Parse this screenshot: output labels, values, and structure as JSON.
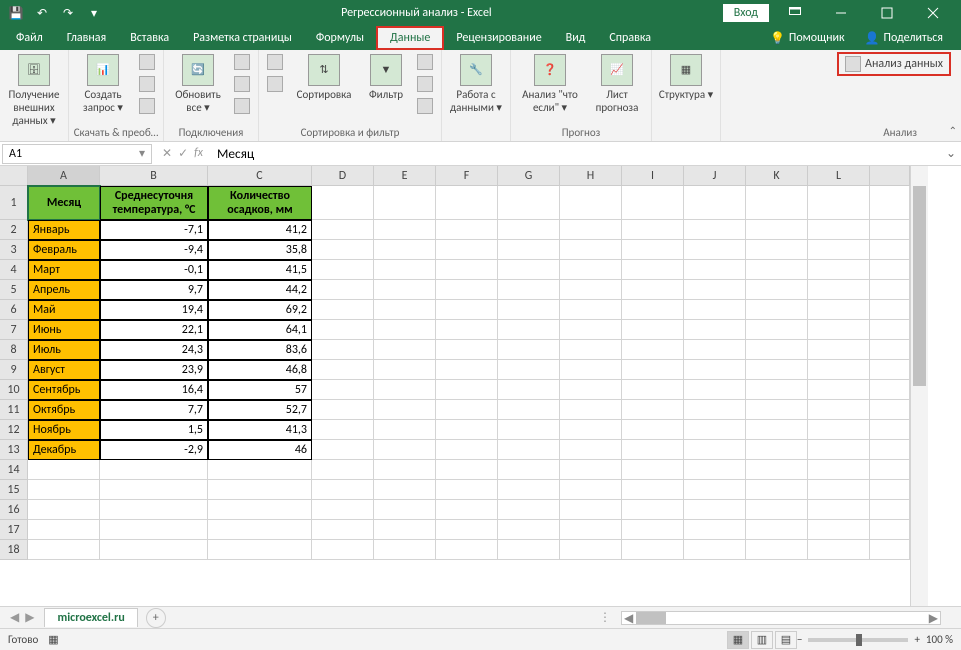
{
  "title": "Регрессионный анализ  -  Excel",
  "signin": "Вход",
  "tabs": [
    "Файл",
    "Главная",
    "Вставка",
    "Разметка страницы",
    "Формулы",
    "Данные",
    "Рецензирование",
    "Вид",
    "Справка"
  ],
  "active_tab": "Данные",
  "ribbon_right": {
    "tell_me": "Помощник",
    "share": "Поделиться"
  },
  "ribbon": {
    "external": {
      "btn": "Получение внешних данных ▾"
    },
    "get_transform": {
      "btn": "Создать запрос ▾",
      "label": "Скачать & преоб…"
    },
    "connections": {
      "btn": "Обновить все ▾",
      "label": "Подключения"
    },
    "sort_filter": {
      "sort": "Сортировка",
      "filter": "Фильтр",
      "label": "Сортировка и фильтр"
    },
    "data_tools": {
      "btn": "Работа с данными ▾"
    },
    "forecast": {
      "whatif": "Анализ \"что если\" ▾",
      "sheet": "Лист прогноза",
      "label": "Прогноз"
    },
    "outline": {
      "btn": "Структура ▾"
    },
    "analysis": {
      "btn": "Анализ данных",
      "label": "Анализ"
    }
  },
  "name_box": "A1",
  "formula": "Месяц",
  "columns": [
    "A",
    "B",
    "C",
    "D",
    "E",
    "F",
    "G",
    "H",
    "I",
    "J",
    "K",
    "L"
  ],
  "row_count": 17,
  "header_row_height": 34,
  "headers": {
    "A": "Месяц",
    "B": "Среднесуточня температура, °C",
    "C": "Количество осадков, мм"
  },
  "rows": [
    {
      "month": "Январь",
      "temp": "-7,1",
      "prec": "41,2"
    },
    {
      "month": "Февраль",
      "temp": "-9,4",
      "prec": "35,8"
    },
    {
      "month": "Март",
      "temp": "-0,1",
      "prec": "41,5"
    },
    {
      "month": "Апрель",
      "temp": "9,7",
      "prec": "44,2"
    },
    {
      "month": "Май",
      "temp": "19,4",
      "prec": "69,2"
    },
    {
      "month": "Июнь",
      "temp": "22,1",
      "prec": "64,1"
    },
    {
      "month": "Июль",
      "temp": "24,3",
      "prec": "83,6"
    },
    {
      "month": "Август",
      "temp": "23,9",
      "prec": "46,8"
    },
    {
      "month": "Сентябрь",
      "temp": "16,4",
      "prec": "57"
    },
    {
      "month": "Октябрь",
      "temp": "7,7",
      "prec": "52,7"
    },
    {
      "month": "Ноябрь",
      "temp": "1,5",
      "prec": "41,3"
    },
    {
      "month": "Декабрь",
      "temp": "-2,9",
      "prec": "46"
    }
  ],
  "sheet_tab": "microexcel.ru",
  "status": "Готово",
  "zoom": "100 %"
}
